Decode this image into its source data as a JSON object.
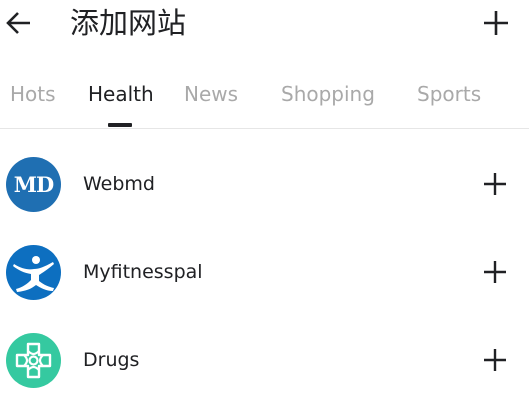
{
  "header": {
    "title": "添加网站",
    "back_icon": "arrow-left-icon",
    "add_icon": "plus-icon"
  },
  "tabs": [
    {
      "label": "Hots",
      "active": false
    },
    {
      "label": "Health",
      "active": true
    },
    {
      "label": "News",
      "active": false
    },
    {
      "label": "Shopping",
      "active": false
    },
    {
      "label": "Sports",
      "active": false
    }
  ],
  "sites": [
    {
      "name": "Webmd",
      "logo_text": "MD",
      "logo_color": "#1f6fb2",
      "add_icon": "plus-icon"
    },
    {
      "name": "Myfitnesspal",
      "logo_icon": "runner-icon",
      "logo_color": "#0d6fc0",
      "add_icon": "plus-icon"
    },
    {
      "name": "Drugs",
      "logo_icon": "cross-icon",
      "logo_color": "#35c9a0",
      "add_icon": "plus-icon"
    }
  ],
  "colors": {
    "text_primary": "#202124",
    "tab_inactive": "#a9a9a9",
    "divider": "#e6e6e6"
  }
}
